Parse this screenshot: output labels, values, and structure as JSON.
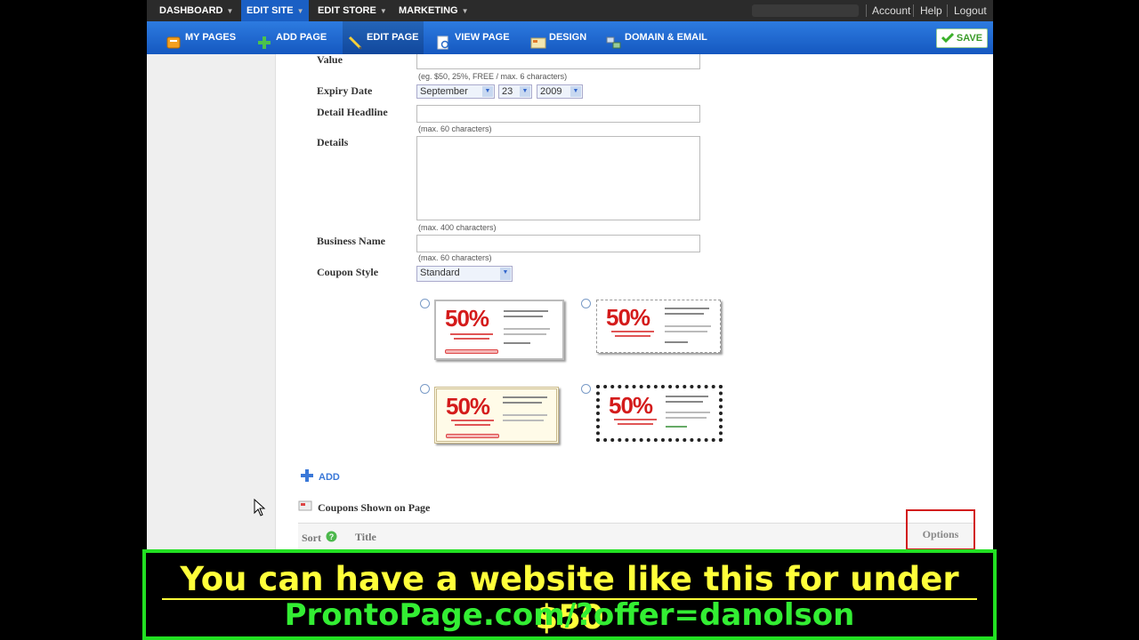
{
  "topnav": {
    "items": [
      "DASHBOARD",
      "EDIT SITE",
      "EDIT STORE",
      "MARKETING"
    ],
    "account": "Account",
    "help": "Help",
    "logout": "Logout"
  },
  "toolbar": {
    "my_pages": "MY PAGES",
    "add_page": "ADD PAGE",
    "edit_page": "EDIT PAGE",
    "view_page": "VIEW PAGE",
    "design": "DESIGN",
    "domain_email": "DOMAIN & EMAIL",
    "save": "SAVE"
  },
  "form": {
    "value_label": "Value",
    "value_hint": "(eg. $50, 25%, FREE / max. 6 characters)",
    "expiry_label": "Expiry Date",
    "expiry_month": "September",
    "expiry_day": "23",
    "expiry_year": "2009",
    "detail_headline_label": "Detail Headline",
    "detail_headline_hint": "(max. 60 characters)",
    "details_label": "Details",
    "details_hint": "(max. 400 characters)",
    "business_name_label": "Business Name",
    "business_name_hint": "(max. 60 characters)",
    "coupon_style_label": "Coupon Style",
    "coupon_style_value": "Standard"
  },
  "coupon_styles": [
    {
      "pct": "50%"
    },
    {
      "pct": "50%"
    },
    {
      "pct": "50%"
    },
    {
      "pct": "50%"
    }
  ],
  "add_label": "ADD",
  "coupons_list": {
    "header": "Coupons Shown on Page",
    "col_sort": "Sort",
    "col_title": "Title",
    "options": "Options"
  },
  "banner": {
    "line1": "You can have a website like this for under $50",
    "line2": "ProntoPage.com/?offer=danolson"
  },
  "colors": {
    "nav_dark": "#2b2b2b",
    "toolbar_blue": "#1e6ad4",
    "coupon_red": "#d41b1b",
    "banner_yellow": "#ffff3a",
    "banner_green": "#33ee33"
  }
}
